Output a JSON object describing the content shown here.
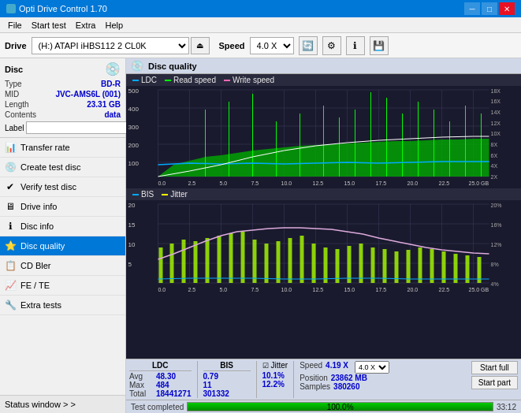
{
  "app": {
    "title": "Opti Drive Control 1.70",
    "icon": "💿"
  },
  "titlebar": {
    "title": "Opti Drive Control 1.70",
    "minimize": "─",
    "maximize": "□",
    "close": "✕"
  },
  "menu": {
    "items": [
      "File",
      "Start test",
      "Extra",
      "Help"
    ]
  },
  "toolbar": {
    "drive_label": "Drive",
    "drive_value": "(H:) ATAPI iHBS112 2 CL0K",
    "speed_label": "Speed",
    "speed_value": "4.0 X"
  },
  "disc": {
    "title": "Disc",
    "type_label": "Type",
    "type_value": "BD-R",
    "mid_label": "MID",
    "mid_value": "JVC-AMS6L (001)",
    "length_label": "Length",
    "length_value": "23.31 GB",
    "contents_label": "Contents",
    "contents_value": "data",
    "label_label": "Label"
  },
  "nav": {
    "items": [
      {
        "id": "transfer-rate",
        "label": "Transfer rate",
        "icon": "📊"
      },
      {
        "id": "create-test-disc",
        "label": "Create test disc",
        "icon": "💿"
      },
      {
        "id": "verify-test-disc",
        "label": "Verify test disc",
        "icon": "✔"
      },
      {
        "id": "drive-info",
        "label": "Drive info",
        "icon": "🖥"
      },
      {
        "id": "disc-info",
        "label": "Disc info",
        "icon": "ℹ"
      },
      {
        "id": "disc-quality",
        "label": "Disc quality",
        "icon": "⭐",
        "active": true
      },
      {
        "id": "cd-bler",
        "label": "CD Bler",
        "icon": "📋"
      },
      {
        "id": "fe-te",
        "label": "FE / TE",
        "icon": "📈"
      },
      {
        "id": "extra-tests",
        "label": "Extra tests",
        "icon": "🔧"
      }
    ],
    "status_window": "Status window > >"
  },
  "chart": {
    "title": "Disc quality",
    "legend_top": {
      "ldc": "LDC",
      "read": "Read speed",
      "write": "Write speed"
    },
    "legend_bottom": {
      "bis": "BIS",
      "jitter": "Jitter"
    },
    "top_yaxis": {
      "left": [
        500,
        400,
        300,
        200,
        100
      ],
      "right": [
        "18X",
        "16X",
        "14X",
        "12X",
        "10X",
        "8X",
        "6X",
        "4X",
        "2X"
      ]
    },
    "bottom_yaxis": {
      "left": [
        20,
        15,
        10,
        5
      ],
      "right": [
        "20%",
        "16%",
        "12%",
        "8%",
        "4%"
      ]
    },
    "xaxis": [
      0.0,
      2.5,
      5.0,
      7.5,
      10.0,
      12.5,
      15.0,
      17.5,
      20.0,
      22.5,
      25.0
    ]
  },
  "stats": {
    "ldc_header": "LDC",
    "bis_header": "BIS",
    "jitter_header": "Jitter",
    "avg_label": "Avg",
    "max_label": "Max",
    "total_label": "Total",
    "ldc_avg": "48.30",
    "ldc_max": "484",
    "ldc_total": "18441271",
    "bis_avg": "0.79",
    "bis_max": "11",
    "bis_total": "301332",
    "jitter_avg": "10.1%",
    "jitter_max": "12.2%",
    "speed_label": "Speed",
    "speed_value": "4.19 X",
    "speed_setting": "4.0 X",
    "position_label": "Position",
    "position_value": "23862 MB",
    "samples_label": "Samples",
    "samples_value": "380260",
    "btn_start_full": "Start full",
    "btn_start_part": "Start part"
  },
  "progress": {
    "status": "Test completed",
    "percent": "100.0%",
    "percent_num": 100,
    "time": "33:12"
  },
  "colors": {
    "accent": "#0078d7",
    "ldc_line": "#00aaff",
    "read_speed": "#00ff00",
    "write_speed": "#ff69b4",
    "bis_line": "#00aaff",
    "jitter_bars": "#aaff00",
    "grid": "#3a3a5e",
    "bg": "#1a1a2e",
    "active_nav": "#0078d7"
  }
}
